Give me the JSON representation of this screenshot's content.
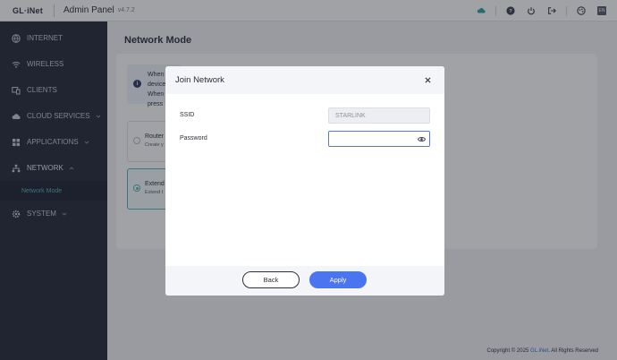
{
  "header": {
    "logo": "GL·iNet",
    "title": "Admin Panel",
    "version": "v4.7.2",
    "icons": [
      "cloud-icon",
      "help-icon",
      "power-icon",
      "logout-icon",
      "theme-icon",
      "language-icon"
    ],
    "language_badge": "EN",
    "cloud_color": "#2a9fa4"
  },
  "sidebar": {
    "items": [
      {
        "label": "INTERNET",
        "icon": "globe-icon"
      },
      {
        "label": "WIRELESS",
        "icon": "wifi-icon"
      },
      {
        "label": "CLIENTS",
        "icon": "devices-icon"
      },
      {
        "label": "CLOUD SERVICES",
        "icon": "cloud-icon",
        "expandable": true
      },
      {
        "label": "APPLICATIONS",
        "icon": "grid-icon",
        "expandable": true
      },
      {
        "label": "NETWORK",
        "icon": "network-icon",
        "expanded": true
      },
      {
        "label": "SYSTEM",
        "icon": "gear-icon",
        "expandable": true
      }
    ],
    "sub_item": "Network Mode"
  },
  "main": {
    "title": "Network Mode",
    "info_lines": [
      "When",
      "device",
      "When",
      "press"
    ],
    "options": [
      {
        "title": "Router",
        "desc": "Create y",
        "selected": false
      },
      {
        "title": "Extend",
        "desc": "Extend t",
        "selected": true
      }
    ],
    "footer_prefix": "Copyright © 2025",
    "footer_brand": "GL.iNet",
    "footer_suffix": ". All Rights Reserved"
  },
  "modal": {
    "title": "Join Network",
    "ssid_label": "SSID",
    "ssid_value": "STARLINK",
    "password_label": "Password",
    "password_value": "",
    "back_label": "Back",
    "apply_label": "Apply",
    "accent": "#4b74f0"
  }
}
